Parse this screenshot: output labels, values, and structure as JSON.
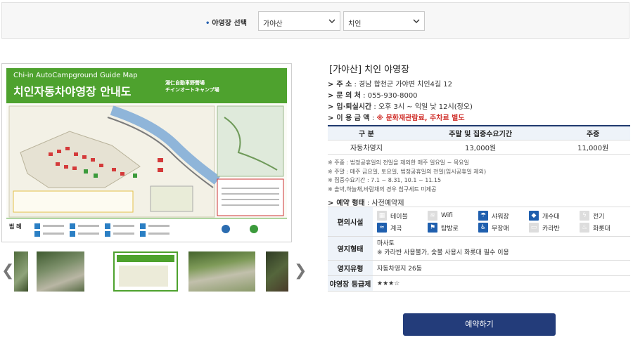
{
  "selector": {
    "label": "야영장 선택",
    "region": "가야산",
    "site": "치인"
  },
  "map": {
    "en_title": "Chi-in AutoCampground Guide Map",
    "ko_title": "치인자동차야영장 안내도",
    "jp_line1": "湯仁自動車野營場",
    "jp_line2": "チインオートキャンプ場",
    "legend_title": "범 례"
  },
  "gallery": {
    "prev": "❮",
    "next": "❯"
  },
  "info": {
    "title": "[가야산] 치인 야영장",
    "address_label": "주       소",
    "address": ": 경남 합천군 가야면 치인4길 12",
    "phone_label": "문   의   처",
    "phone": ": 055-930-8000",
    "checkin_label": "입·퇴실시간",
    "checkin": ": 오후 3시 ~ 익일 낮 12시(정오)",
    "fee_label": "이 용 금 액",
    "fee_note": "※ 문화재관람료, 주차료 별도",
    "reservation_label": "예약 형태",
    "reservation": ": 사전예약제"
  },
  "price_table": {
    "headers": [
      "구 분",
      "주말 및 집중수요기간",
      "주중"
    ],
    "rows": [
      [
        "자동차영지",
        "13,000원",
        "11,000원"
      ]
    ]
  },
  "notes": [
    "※ 주중 : 법정공휴일의 전일을 제외한 매주 일요일 ~ 목요일",
    "※ 주말 : 매주 금요일, 토요일, 법정공휴일의 전일(임시공휴일 제외)",
    "※ 집중수요기간 : 7.1 ~ 8.31, 10.1 ~ 11.15",
    "※ 솔박,하늘채,바람채의 경우 침구세트 미제공"
  ],
  "facilities": {
    "label": "편의시설",
    "items": [
      {
        "name": "테이블",
        "icon": "table-icon",
        "available": false
      },
      {
        "name": "Wifi",
        "icon": "wifi-icon",
        "available": false
      },
      {
        "name": "샤워장",
        "icon": "shower-icon",
        "available": true
      },
      {
        "name": "개수대",
        "icon": "sink-icon",
        "available": true
      },
      {
        "name": "전기",
        "icon": "electric-icon",
        "available": false
      },
      {
        "name": "계곡",
        "icon": "valley-icon",
        "available": true
      },
      {
        "name": "탐방로",
        "icon": "trail-icon",
        "available": true
      },
      {
        "name": "무장애",
        "icon": "accessible-icon",
        "available": true
      },
      {
        "name": "카라반",
        "icon": "caravan-icon",
        "available": false
      },
      {
        "name": "화롯대",
        "icon": "brazier-icon",
        "available": false
      }
    ]
  },
  "site_type": {
    "label": "영지형태",
    "value": "마사토",
    "note": "※ 카라반 사용불가, 숯불 사용시 화롯대 필수 이용"
  },
  "site_kind": {
    "label": "영지유형",
    "value": "자동차영지 26동"
  },
  "grade": {
    "label": "야영장 등급제",
    "stars": "★★★☆",
    "rating": 3.5,
    "max": 4
  },
  "reserve_button": "예약하기",
  "colors": {
    "brand_green": "#4ea22e",
    "navy": "#233c7a",
    "accent_blue": "#1f5fae",
    "alert_red": "#d0302b"
  }
}
